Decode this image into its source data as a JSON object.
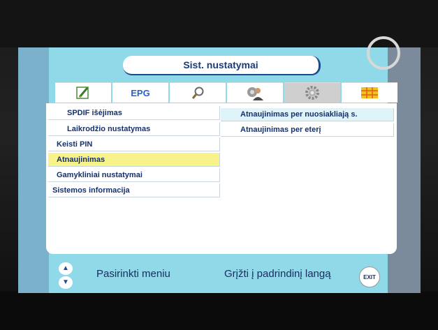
{
  "title": "Sist. nustatymai",
  "tabs": [
    {
      "id": "edit",
      "icon": "pencil-icon"
    },
    {
      "id": "epg",
      "label": "EPG"
    },
    {
      "id": "search",
      "icon": "magnifier-icon"
    },
    {
      "id": "user",
      "icon": "settings-user-icon"
    },
    {
      "id": "system",
      "icon": "gear-icon",
      "active": true
    },
    {
      "id": "card",
      "icon": "smartcard-icon"
    }
  ],
  "menu": {
    "items": [
      {
        "label": "SPDIF išėjimas"
      },
      {
        "label": "Laikrodžio nustatymas"
      },
      {
        "label": "Keisti PIN"
      },
      {
        "label": "Atnaujinimas",
        "selected": true
      },
      {
        "label": "Gamykliniai nustatymai"
      },
      {
        "label": "Sistemos informacija"
      }
    ]
  },
  "submenu": {
    "items": [
      {
        "label": "Atnaujinimas per nuosiakliają s."
      },
      {
        "label": "Atnaujinimas per eterį"
      }
    ]
  },
  "footer": {
    "select_label": "Pasirinkti meniu",
    "back_label": "Grįžti į padrindinį langą",
    "exit_label": "EXIT"
  },
  "colors": {
    "panel": "#8fd9e8",
    "selected": "#f7f28a",
    "text": "#15306e"
  }
}
